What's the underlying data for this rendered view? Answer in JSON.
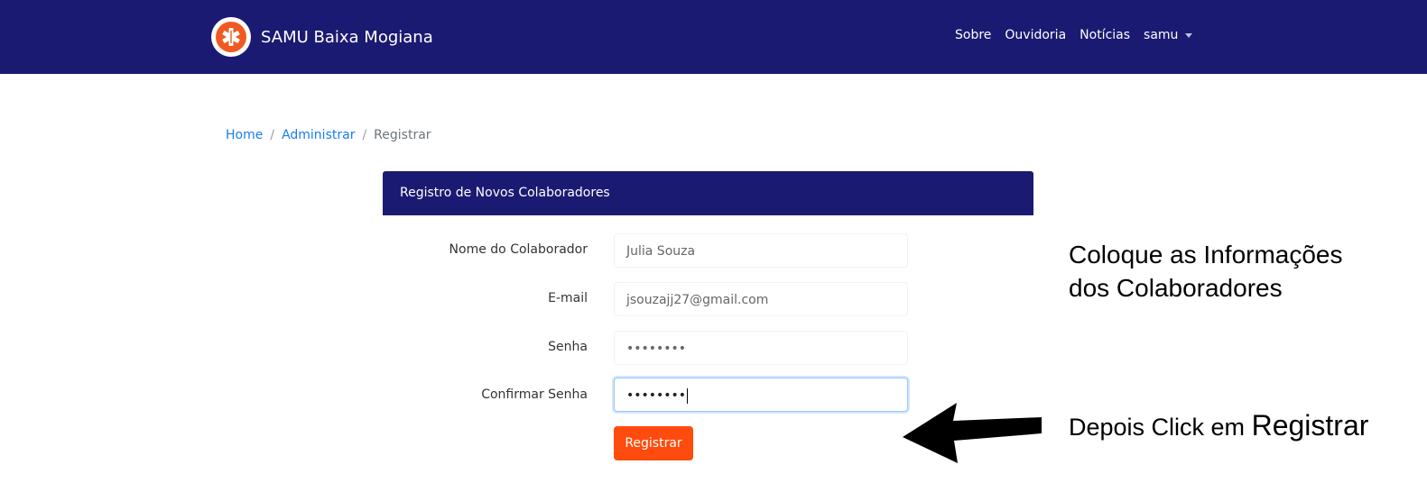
{
  "app": {
    "brand": "SAMU Baixa Mogiana",
    "logo_icon": "star-of-life-icon",
    "colors": {
      "navbar": "#1b1a72",
      "accent": "#ff4b0e",
      "link": "#1a7cf2"
    }
  },
  "nav": {
    "links": [
      "Sobre",
      "Ouvidoria",
      "Notícias"
    ],
    "user": "samu"
  },
  "breadcrumb": {
    "home": "Home",
    "admin": "Administrar",
    "current": "Registrar"
  },
  "form": {
    "header": "Registro de Novos Colaboradores",
    "fields": [
      {
        "label": "Nome do Colaborador",
        "value": "Julia Souza"
      },
      {
        "label": "E-mail",
        "value": "jsouzajj27@gmail.com"
      },
      {
        "label": "Senha",
        "value": "••••••••"
      },
      {
        "label": "Confirmar Senha",
        "value": "••••••••"
      }
    ],
    "submit": "Registrar"
  },
  "annotations": {
    "note1_line1": "Coloque as Informações",
    "note1_line2": "dos Colaboradores",
    "note2_prefix": "Depois Click em",
    "note2_emphasis": "Registrar"
  }
}
